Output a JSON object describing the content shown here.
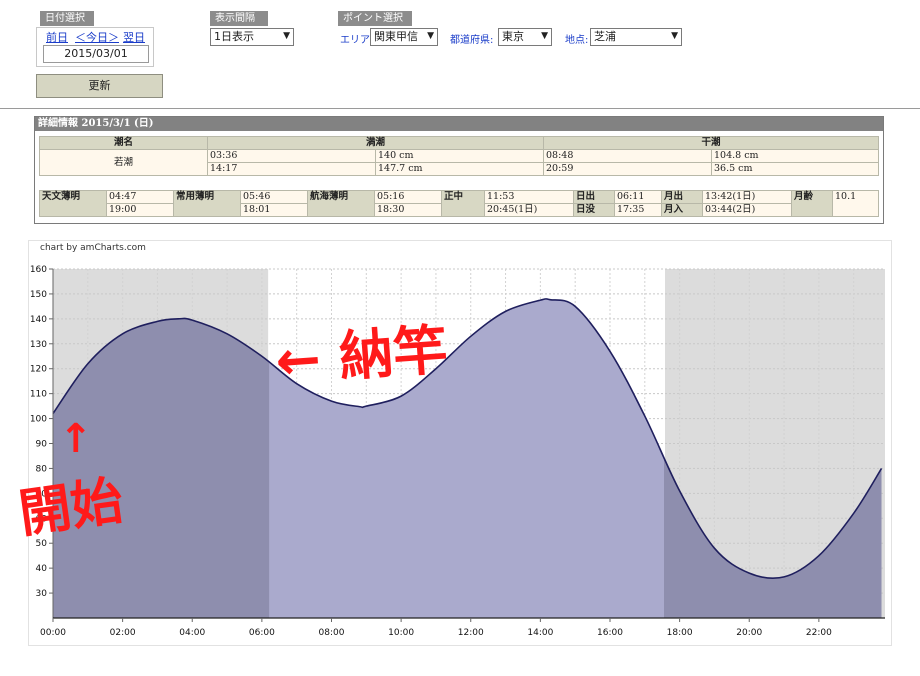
{
  "date_panel": {
    "label": "日付選択",
    "prev": "前日",
    "today": "＜今日＞",
    "next": "翌日",
    "date_value": "2015/03/01"
  },
  "update_button": "更新",
  "interval_panel": {
    "label": "表示間隔",
    "selected": "1日表示"
  },
  "point_panel": {
    "label": "ポイント選択",
    "area_label": "エリア:",
    "area_value": "関東甲信",
    "pref_label": "都道府県:",
    "pref_value": "東京",
    "spot_label": "地点:",
    "spot_value": "芝浦"
  },
  "detail": {
    "header": "詳細情報  2015/3/1 (日)",
    "tide_headers": [
      "潮名",
      "満潮",
      "干潮"
    ],
    "tide_name": "若潮",
    "high_tides": [
      {
        "time": "03:36",
        "level": "140 cm"
      },
      {
        "time": "14:17",
        "level": "147.7 cm"
      }
    ],
    "low_tides": [
      {
        "time": "08:48",
        "level": "104.8 cm"
      },
      {
        "time": "20:59",
        "level": "36.5 cm"
      }
    ],
    "astro": {
      "astro_twilight_label": "天文薄明",
      "astro_twilight": [
        "04:47",
        "19:00"
      ],
      "civil_twilight_label": "常用薄明",
      "civil_twilight": [
        "05:46",
        "18:01"
      ],
      "nautical_twilight_label": "航海薄明",
      "nautical_twilight": [
        "05:16",
        "18:30"
      ],
      "transit_label": "正中",
      "transit": [
        "11:53",
        "20:45(1日)"
      ],
      "sunrise_label": "日出",
      "sunrise": "06:11",
      "sunset_label": "日没",
      "sunset": "17:35",
      "moonrise_label": "月出",
      "moonrise": "13:42(1日)",
      "moonset_label": "月入",
      "moonset": "03:44(2日)",
      "moon_age_label": "月齢",
      "moon_age": "10.1"
    }
  },
  "chart_credit": "chart by amCharts.com",
  "chart_data": {
    "type": "area",
    "x_unit": "hour",
    "x": [
      0,
      1,
      2,
      3,
      3.6,
      4,
      5,
      6,
      7,
      8,
      8.8,
      9,
      10,
      11,
      12,
      13,
      14,
      14.28,
      15,
      16,
      17,
      18,
      19,
      20,
      21,
      22,
      23,
      23.8
    ],
    "y": [
      102,
      122,
      134,
      139,
      140,
      139.5,
      134,
      125,
      114,
      107,
      104.8,
      105,
      109,
      120,
      133,
      143,
      147.5,
      147.7,
      145,
      127,
      101,
      71,
      48,
      38,
      36.5,
      45,
      62,
      80
    ],
    "xlim": [
      0,
      23.9
    ],
    "ylim": [
      20,
      160
    ],
    "y_ticks": [
      30,
      40,
      50,
      60,
      70,
      80,
      90,
      100,
      110,
      120,
      130,
      140,
      150,
      160
    ],
    "x_ticks": [
      0,
      2,
      4,
      6,
      8,
      10,
      12,
      14,
      16,
      18,
      20,
      22
    ],
    "x_tick_labels": [
      "00:00",
      "02:00",
      "04:00",
      "06:00",
      "08:00",
      "10:00",
      "12:00",
      "14:00",
      "16:00",
      "18:00",
      "20:00",
      "22:00"
    ],
    "night_bands": [
      [
        0,
        6.18
      ],
      [
        17.58,
        23.9
      ]
    ],
    "grid": true,
    "annotations": [
      {
        "text": "← 納竿",
        "at_x": 6.2,
        "color": "#ff1a1a"
      },
      {
        "text": "↑ 開始",
        "at_x": 0,
        "color": "#ff1a1a"
      }
    ],
    "colors": {
      "line": "#1f1f5e",
      "fill_day": "#aaaacd",
      "fill_night": "#8e8eae",
      "night_band": "#dcdcdc",
      "annotation": "#ff1a1a"
    }
  }
}
